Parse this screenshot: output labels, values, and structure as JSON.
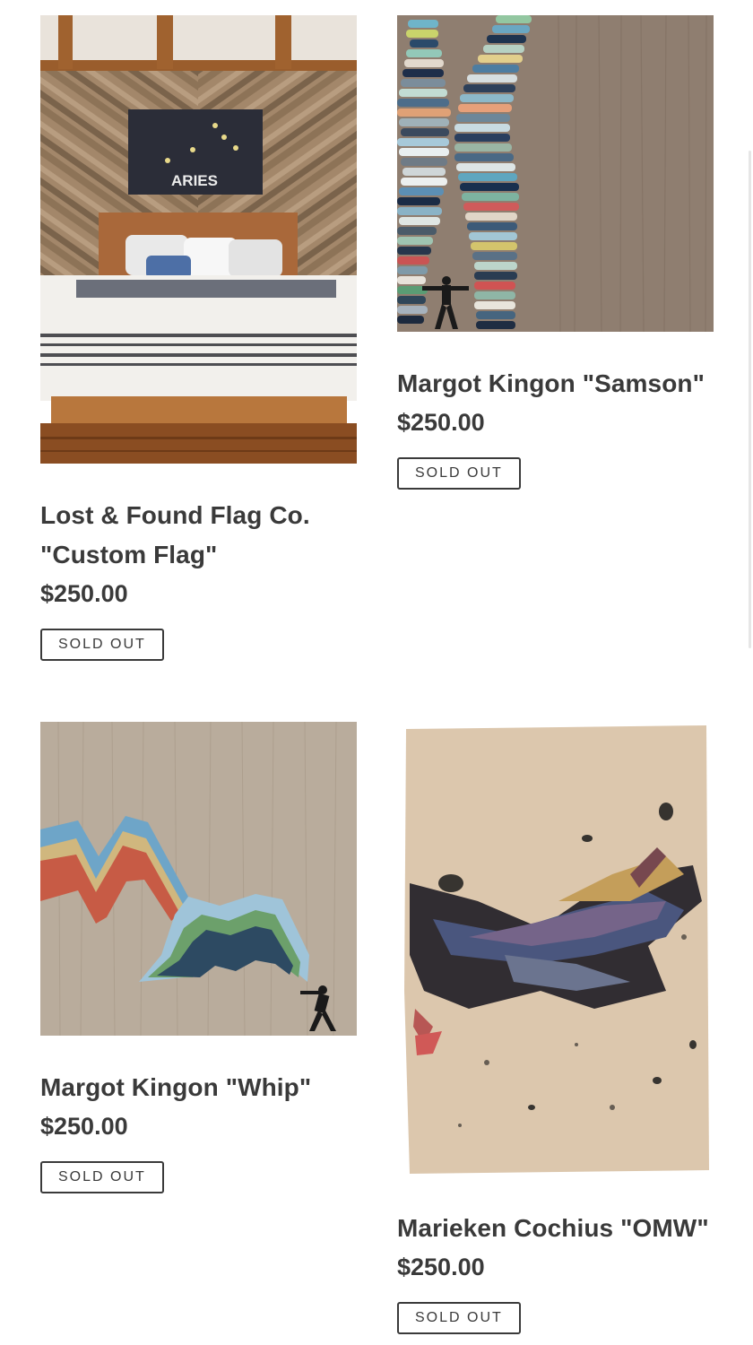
{
  "products": [
    {
      "title_line1": "Lost & Found Flag Co.",
      "title_line2": "\"Custom Flag\"",
      "price": "$250.00",
      "badge": "SOLD OUT",
      "flag_text": "ARIES"
    },
    {
      "title_line1": "Margot Kingon \"Samson\"",
      "price": "$250.00",
      "badge": "SOLD OUT"
    },
    {
      "title_line1": "Margot Kingon \"Whip\"",
      "price": "$250.00",
      "badge": "SOLD OUT"
    },
    {
      "title_line1": "Marieken Cochius \"OMW\"",
      "price": "$250.00",
      "badge": "SOLD OUT"
    }
  ],
  "colors": {
    "text": "#3a3a3a",
    "background": "#ffffff"
  }
}
